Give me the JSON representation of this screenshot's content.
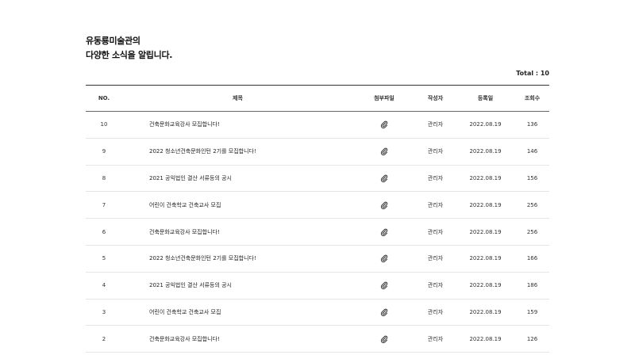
{
  "heading": {
    "line1": "유동룡미술관의",
    "line2": "다양한 소식을 알립니다."
  },
  "total_label": "Total : 10",
  "columns": {
    "no": "NO.",
    "title": "제목",
    "attachment": "첨부파일",
    "author": "작성자",
    "date": "등록일",
    "views": "조회수"
  },
  "attachment_icon": "paperclip-icon",
  "rows": [
    {
      "no": "10",
      "title": "건축문화교육강사 모집합니다!",
      "author": "관리자",
      "date": "2022.08.19",
      "views": "136"
    },
    {
      "no": "9",
      "title": "2022 청소년건축문화인턴 2기를 모집합니다!",
      "author": "관리자",
      "date": "2022.08.19",
      "views": "146"
    },
    {
      "no": "8",
      "title": "2021 공익법인 결산 서류등의 공시",
      "author": "관리자",
      "date": "2022.08.19",
      "views": "156"
    },
    {
      "no": "7",
      "title": "어린이 건축학교 건축교사 모집",
      "author": "관리자",
      "date": "2022.08.19",
      "views": "256"
    },
    {
      "no": "6",
      "title": "건축문화교육강사 모집합니다!",
      "author": "관리자",
      "date": "2022.08.19",
      "views": "256"
    },
    {
      "no": "5",
      "title": "2022 청소년건축문화인턴 2기를 모집합니다!",
      "author": "관리자",
      "date": "2022.08.19",
      "views": "166"
    },
    {
      "no": "4",
      "title": "2021 공익법인 결산 서류등의 공시",
      "author": "관리자",
      "date": "2022.08.19",
      "views": "186"
    },
    {
      "no": "3",
      "title": "어린이 건축학교 건축교사 모집",
      "author": "관리자",
      "date": "2022.08.19",
      "views": "159"
    },
    {
      "no": "2",
      "title": "건축문화교육강사 모집합니다!",
      "author": "관리자",
      "date": "2022.08.19",
      "views": "126"
    }
  ]
}
